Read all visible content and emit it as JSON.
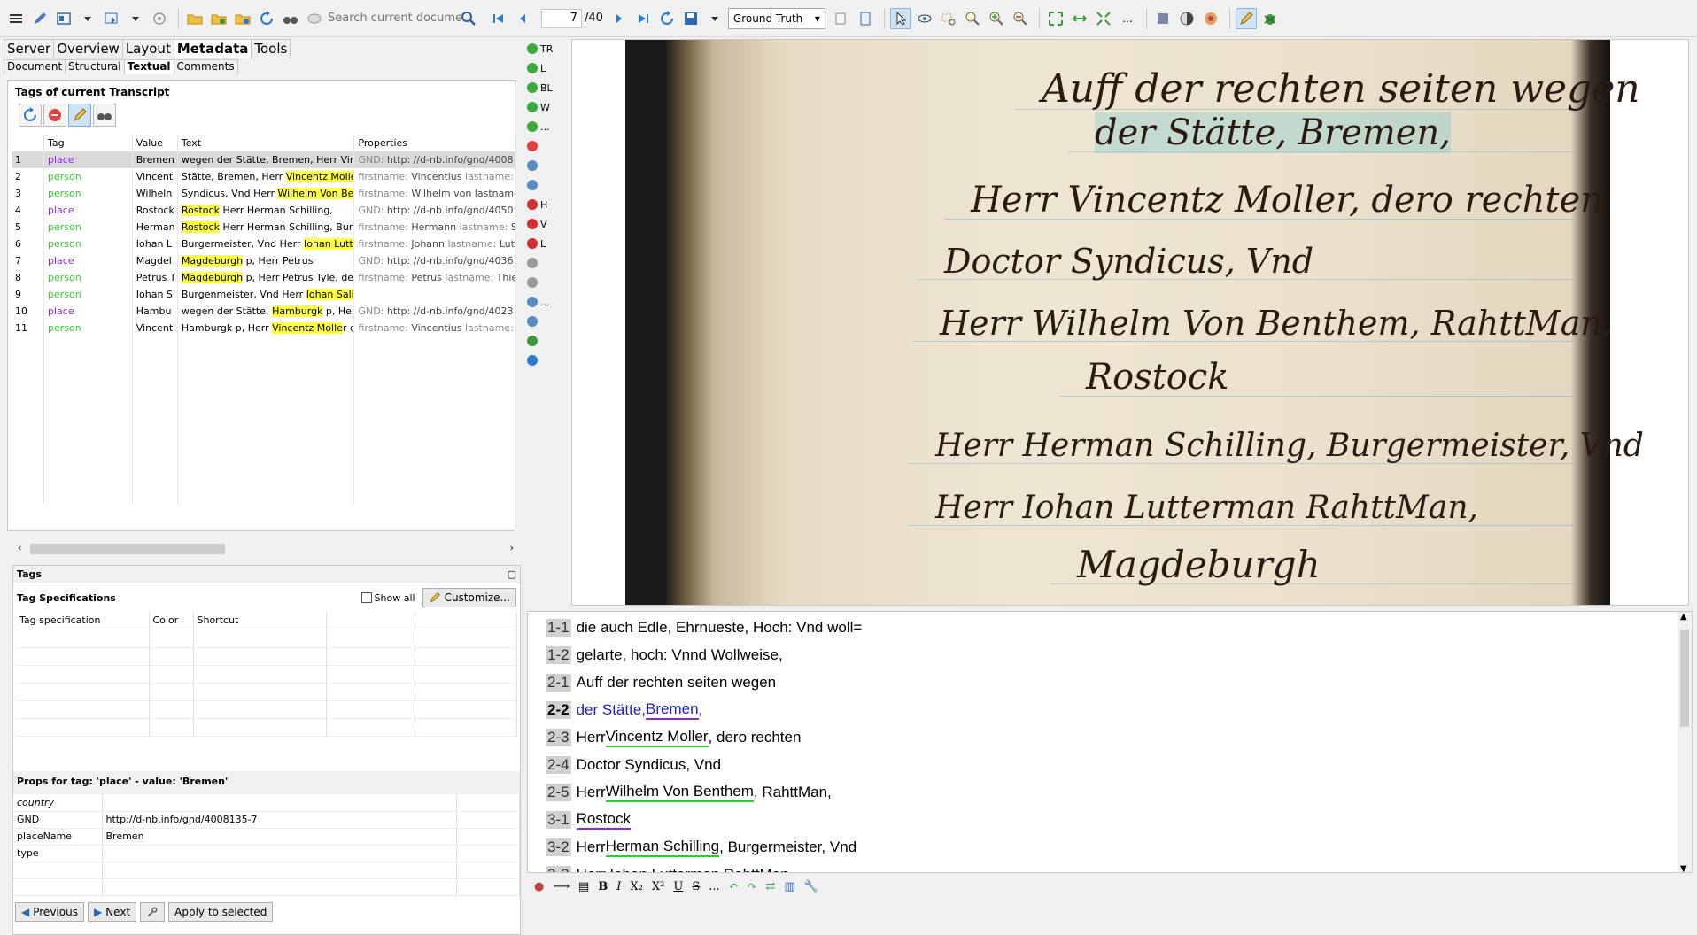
{
  "toolbar": {
    "search_placeholder": "Search current document...",
    "page_current": "7",
    "page_total": "/40",
    "version": "Ground Truth"
  },
  "left": {
    "tabs": [
      "Server",
      "Overview",
      "Layout",
      "Metadata",
      "Tools"
    ],
    "subtabs": [
      "Document",
      "Structural",
      "Textual",
      "Comments"
    ],
    "section_title": "Tags of current Transcript",
    "columns": [
      "",
      "Tag",
      "Value",
      "Text",
      "Properties"
    ],
    "rows": [
      {
        "n": "1",
        "tag": "place",
        "value": "Bremen",
        "text": " wegen der Stätte, Bremen, Herr Vinc",
        "props": "GND: http: //d-nb.info/gnd/4008"
      },
      {
        "n": "2",
        "tag": "person",
        "value": "Vincent",
        "text": " Stätte, Bremen, Herr Vincentz Molle",
        "props": "firstname: Vincentius lastname: M"
      },
      {
        "n": "3",
        "tag": "person",
        "value": "Wilheln",
        "text": " Syndicus, Vnd Herr Wilhelm Von Be",
        "props": "firstname: Wilhelm von lastname"
      },
      {
        "n": "4",
        "tag": "place",
        "value": "Rostock",
        "text": "Rostock Herr Herman Schilling,",
        "props": "GND: http: //d-nb.info/gnd/4050"
      },
      {
        "n": "5",
        "tag": "person",
        "value": "Herman",
        "text": "Rostock Herr Herman Schilling, Burg",
        "props": "firstname: Hermann lastname: Sc"
      },
      {
        "n": "6",
        "tag": "person",
        "value": "Iohan L",
        "text": " Burgermeister, Vnd Herr Iohan Lutte",
        "props": "firstname: Johann lastname: Lutte"
      },
      {
        "n": "7",
        "tag": "place",
        "value": "Magdel",
        "text": "Magdeburgh p, Herr Petrus",
        "props": "GND: http: //d-nb.info/gnd/4036"
      },
      {
        "n": "8",
        "tag": "person",
        "value": "Petrus T",
        "text": "Magdeburgh p, Herr Petrus Tyle, der",
        "props": "firstname: Petrus lastname: Thiele"
      },
      {
        "n": "9",
        "tag": "person",
        "value": "Iohan S",
        "text": "Burgenmeister, Vnd Herr Iohan Salig",
        "props": ""
      },
      {
        "n": "10",
        "tag": "place",
        "value": "Hambu",
        "text": " wegen der Stätte, Hamburgk p, Herr",
        "props": "GND: http: //d-nb.info/gnd/4023"
      },
      {
        "n": "11",
        "tag": "person",
        "value": "Vincent",
        "text": "Hamburgk p, Herr Vincentz Moller d",
        "props": "firstname: Vincentius lastname: M"
      }
    ],
    "tags_header": "Tags",
    "tag_spec_title": "Tag Specifications",
    "show_all": "Show all",
    "customize": "Customize...",
    "spec_columns": [
      "Tag specification",
      "Color",
      "Shortcut"
    ],
    "props_title": "Props for tag: 'place'  -  value: 'Bremen'",
    "props": [
      {
        "k": "country",
        "v": ""
      },
      {
        "k": "GND",
        "v": "http://d-nb.info/gnd/4008135-7"
      },
      {
        "k": "placeName",
        "v": "Bremen"
      },
      {
        "k": "type",
        "v": ""
      }
    ],
    "previous": "Previous",
    "next": "Next",
    "apply": "Apply to selected"
  },
  "mid_tools": [
    "TR",
    "L",
    "BL",
    "W",
    "...",
    "",
    "",
    "",
    "H",
    "V",
    "L",
    "",
    "",
    "...",
    "",
    "",
    ""
  ],
  "handwriting": [
    "Auff der rechten seiten wegen",
    "der Stätte, Bremen,",
    "Herr Vincentz Moller, dero rechten",
    "Doctor Syndicus, Vnd",
    "Herr Wilhelm Von Benthem, RahttMan,",
    "Rostock",
    "Herr Herman Schilling, Burgermeister, Vnd",
    "Herr Iohan Lutterman RahttMan,",
    "Magdeburgh"
  ],
  "editor_lines": [
    {
      "num": "1-1",
      "bold": false,
      "segs": [
        {
          "t": "die auch Edle, Ehrnueste, Hoch: Vnd woll=",
          "c": ""
        }
      ]
    },
    {
      "num": "1-2",
      "bold": false,
      "segs": [
        {
          "t": "gelarte, hoch: Vnnd Wollweise,",
          "c": ""
        }
      ]
    },
    {
      "num": "2-1",
      "bold": false,
      "segs": [
        {
          "t": "Auff der rechten seiten wegen",
          "c": ""
        }
      ]
    },
    {
      "num": "2-2",
      "bold": true,
      "segs": [
        {
          "t": "der Stätte, ",
          "c": "blue"
        },
        {
          "t": "Bremen",
          "c": "blue up"
        },
        {
          "t": ",",
          "c": "blue"
        }
      ]
    },
    {
      "num": "2-3",
      "bold": false,
      "segs": [
        {
          "t": "Herr ",
          "c": ""
        },
        {
          "t": "Vincentz Moller",
          "c": "ug"
        },
        {
          "t": ", dero rechten",
          "c": ""
        }
      ]
    },
    {
      "num": "2-4",
      "bold": false,
      "segs": [
        {
          "t": "Doctor Syndicus, Vnd",
          "c": ""
        }
      ]
    },
    {
      "num": "2-5",
      "bold": false,
      "segs": [
        {
          "t": "Herr ",
          "c": ""
        },
        {
          "t": "Wilhelm Von Benthem",
          "c": "ug"
        },
        {
          "t": ", RahttMan,",
          "c": ""
        }
      ]
    },
    {
      "num": "3-1",
      "bold": false,
      "segs": [
        {
          "t": "Rostock",
          "c": "up"
        }
      ]
    },
    {
      "num": "3-2",
      "bold": false,
      "segs": [
        {
          "t": "Herr ",
          "c": ""
        },
        {
          "t": "Herman Schilling",
          "c": "ug"
        },
        {
          "t": ", Burgermeister, Vnd",
          "c": ""
        }
      ]
    },
    {
      "num": "3-3",
      "bold": false,
      "segs": [
        {
          "t": "Herr Iohan Lutterman RahttMan",
          "c": ""
        }
      ]
    }
  ],
  "format_tools": [
    "B",
    "I",
    "X₂",
    "X²",
    "U",
    "S",
    "..."
  ]
}
